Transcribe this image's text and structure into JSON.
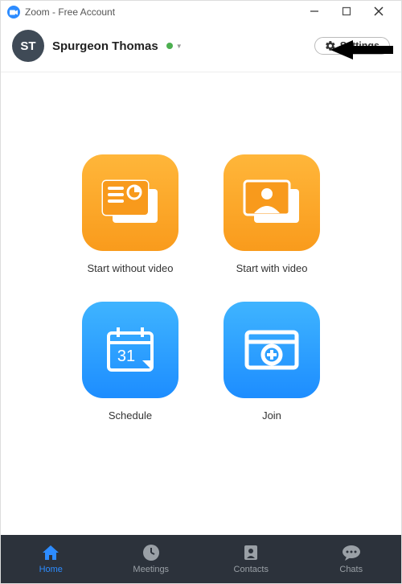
{
  "titlebar": {
    "app_title": "Zoom - Free Account"
  },
  "header": {
    "avatar_initials": "ST",
    "username": "Spurgeon Thomas",
    "settings_label": "Settings"
  },
  "tiles": {
    "start_without_video": "Start without video",
    "start_with_video": "Start with video",
    "schedule": "Schedule",
    "join": "Join",
    "calendar_day": "31"
  },
  "nav": {
    "home": "Home",
    "meetings": "Meetings",
    "contacts": "Contacts",
    "chats": "Chats"
  },
  "colors": {
    "accent_blue": "#2D8CFF",
    "tile_orange_top": "#ffb63a",
    "tile_orange_bottom": "#f99b1c",
    "tile_blue_top": "#3fb4ff",
    "tile_blue_bottom": "#1d8dff",
    "nav_bg": "#2c323b"
  }
}
